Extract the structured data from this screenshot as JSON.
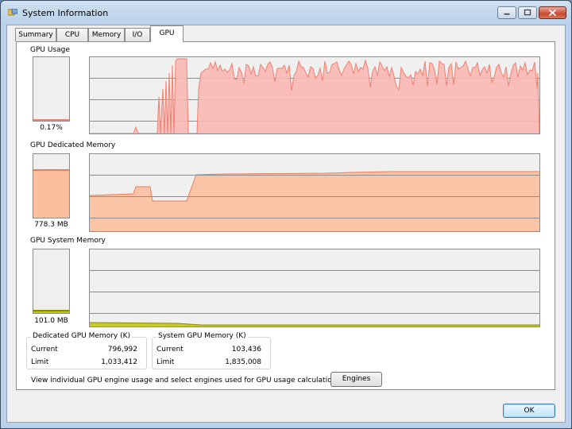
{
  "window": {
    "title": "System Information"
  },
  "tabs": [
    {
      "label": "Summary",
      "active": false
    },
    {
      "label": "CPU",
      "active": false
    },
    {
      "label": "Memory",
      "active": false
    },
    {
      "label": "I/O",
      "active": false
    },
    {
      "label": "GPU",
      "active": true
    }
  ],
  "colors": {
    "gpu_usage_fill": "#f9b8b2",
    "gpu_usage_line": "#f08070",
    "dedicated_fill": "#fbbf9e",
    "dedicated_line": "#f07c55",
    "system_fill": "#c2c414",
    "system_line": "#8a8c00"
  },
  "sections": {
    "gpu_usage": {
      "label": "GPU Usage",
      "value": "0.17%",
      "gauge_fraction": 0.0017
    },
    "dedicated": {
      "label": "GPU Dedicated Memory",
      "value": "778.3 MB",
      "gauge_fraction": 0.76
    },
    "system": {
      "label": "GPU System Memory",
      "value": "101.0 MB",
      "gauge_fraction": 0.05
    }
  },
  "dedicated_memory_group": {
    "title": "Dedicated GPU Memory (K)",
    "current_label": "Current",
    "current_value": "796,992",
    "limit_label": "Limit",
    "limit_value": "1,033,412"
  },
  "system_memory_group": {
    "title": "System GPU Memory (K)",
    "current_label": "Current",
    "current_value": "103,436",
    "limit_label": "Limit",
    "limit_value": "1,835,008"
  },
  "engines_text": "View individual GPU engine usage and select engines used for GPU usage calculations:",
  "engines_button": "Engines",
  "ok_button": "OK"
}
